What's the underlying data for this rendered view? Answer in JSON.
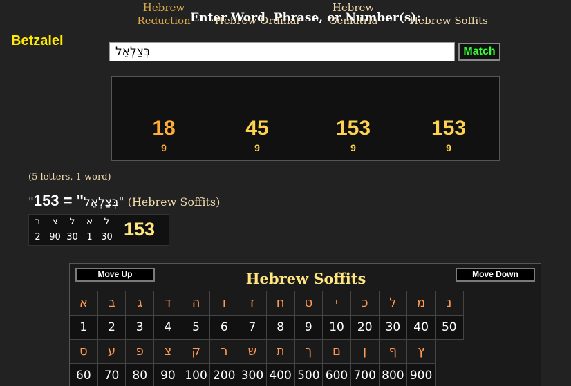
{
  "prompt": "Enter Word, Phrase, or Number(s):",
  "side_title": "Betzalel",
  "entry": {
    "value": "בְּצַלְאֵל"
  },
  "match_button": "Match",
  "ciphers": [
    {
      "label_line1": "Hebrew",
      "label_line2": "Reduction",
      "value": "18",
      "root": "9",
      "tone": "orange"
    },
    {
      "label_line1": "",
      "label_line2": "Hebrew Ordinal",
      "value": "45",
      "root": "9",
      "tone": "yellow"
    },
    {
      "label_line1": "Hebrew",
      "label_line2": "Gematria",
      "value": "153",
      "root": "9",
      "tone": "yellow"
    },
    {
      "label_line1": "",
      "label_line2": "Hebrew Soffits",
      "value": "153",
      "root": "9",
      "tone": "yellow"
    }
  ],
  "count_note": "(5 letters, 1 word)",
  "equation": {
    "quote_open": "\"",
    "number": "153",
    "eq": " = \"",
    "word": "בְּצַלְאֵל",
    "quote_close": "\"",
    "cipher": " (Hebrew Soffits)"
  },
  "breakdown": {
    "letters": [
      "ב",
      "צ",
      "ל",
      "א",
      "ל"
    ],
    "values": [
      "2",
      "90",
      "30",
      "1",
      "30"
    ],
    "total": "153"
  },
  "chart": {
    "move_up": "Move Up",
    "move_down": "Move Down",
    "title": "Hebrew Soffits",
    "row1_letters": [
      "א",
      "ב",
      "ג",
      "ד",
      "ה",
      "ו",
      "ז",
      "ח",
      "ט",
      "י",
      "כ",
      "ל",
      "מ",
      "נ"
    ],
    "row1_values": [
      "1",
      "2",
      "3",
      "4",
      "5",
      "6",
      "7",
      "8",
      "9",
      "10",
      "20",
      "30",
      "40",
      "50"
    ],
    "row2_letters": [
      "ס",
      "ע",
      "פ",
      "צ",
      "ק",
      "ר",
      "ש",
      "ת",
      "ך",
      "ם",
      "ן",
      "ף",
      "ץ"
    ],
    "row2_values": [
      "60",
      "70",
      "80",
      "90",
      "100",
      "200",
      "300",
      "400",
      "500",
      "600",
      "700",
      "800",
      "900"
    ]
  },
  "colors": {
    "background": "#222222",
    "accent_yellow": "#ffea00",
    "match_green": "#33ff33",
    "number_gold": "#ffd24d"
  }
}
